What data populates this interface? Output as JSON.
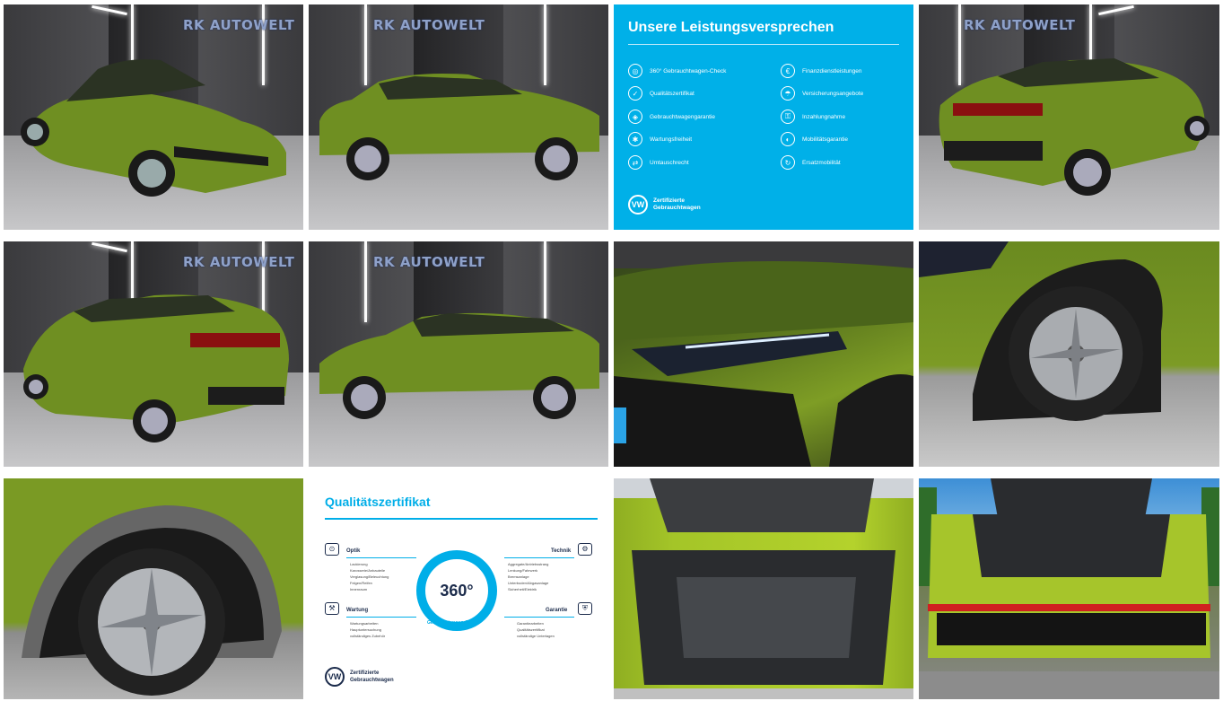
{
  "gallery": {
    "dealer_logo": "RK AUTOWELT",
    "accent_color": "#00b0e8",
    "car_color": "#7a9a24",
    "photos": [
      {
        "icon": "car-front-three-quarter-photo"
      },
      {
        "icon": "car-side-view-photo"
      },
      {
        "icon": "leistungsversprechen-info-card"
      },
      {
        "icon": "car-rear-three-quarter-photo"
      },
      {
        "icon": "car-rear-left-photo"
      },
      {
        "icon": "car-left-side-photo"
      },
      {
        "icon": "headlight-detail-photo"
      },
      {
        "icon": "front-wheel-detail-photo"
      },
      {
        "icon": "rear-wheel-detail-photo"
      },
      {
        "icon": "qualitaetszertifikat-card"
      },
      {
        "icon": "trunk-interior-photo"
      },
      {
        "icon": "rear-open-trunk-photo"
      }
    ]
  },
  "promise": {
    "title": "Unsere Leistungsversprechen",
    "left": [
      "360° Gebrauchtwagen-Check",
      "Qualitätszertifikat",
      "Gebrauchtwagengarantie",
      "Wartungsfreiheit",
      "Umtauschrecht"
    ],
    "right": [
      "Finanzdienstleistungen",
      "Versicherungsangebote",
      "Inzahlungnahme",
      "Mobilitätsgarantie",
      "Ersatzmobilität"
    ],
    "footer_line1": "Zertifizierte",
    "footer_line2": "Gebrauchtwagen"
  },
  "cert": {
    "title": "Qualitätszertifikat",
    "ring_text": "360°",
    "ring_sub": "Gebrauchtwagen-Check",
    "optik_title": "Optik",
    "optik": [
      "Lackierung",
      "Karosserie/Anbauteile",
      "Verglasung/Beleuchtung",
      "Felgen/Reifen",
      "Innenraum"
    ],
    "wartung_title": "Wartung",
    "wartung": [
      "Wartungsarbeiten",
      "Hauptuntersuchung",
      "vollständiges Zubehör"
    ],
    "technik_title": "Technik",
    "technik": [
      "Aggregate/Antriebsstrang",
      "Lenkung/Fahrwerk",
      "Bremsanlage",
      "Unterboden/Abgasanlage",
      "Sicherheit/Elektrik"
    ],
    "garantie_title": "Garantie",
    "garantie": [
      "Garantiearbeiten",
      "Qualitätszertifikat",
      "vollständige Unterlagen"
    ],
    "footer_line1": "Zertifizierte",
    "footer_line2": "Gebrauchtwagen"
  }
}
